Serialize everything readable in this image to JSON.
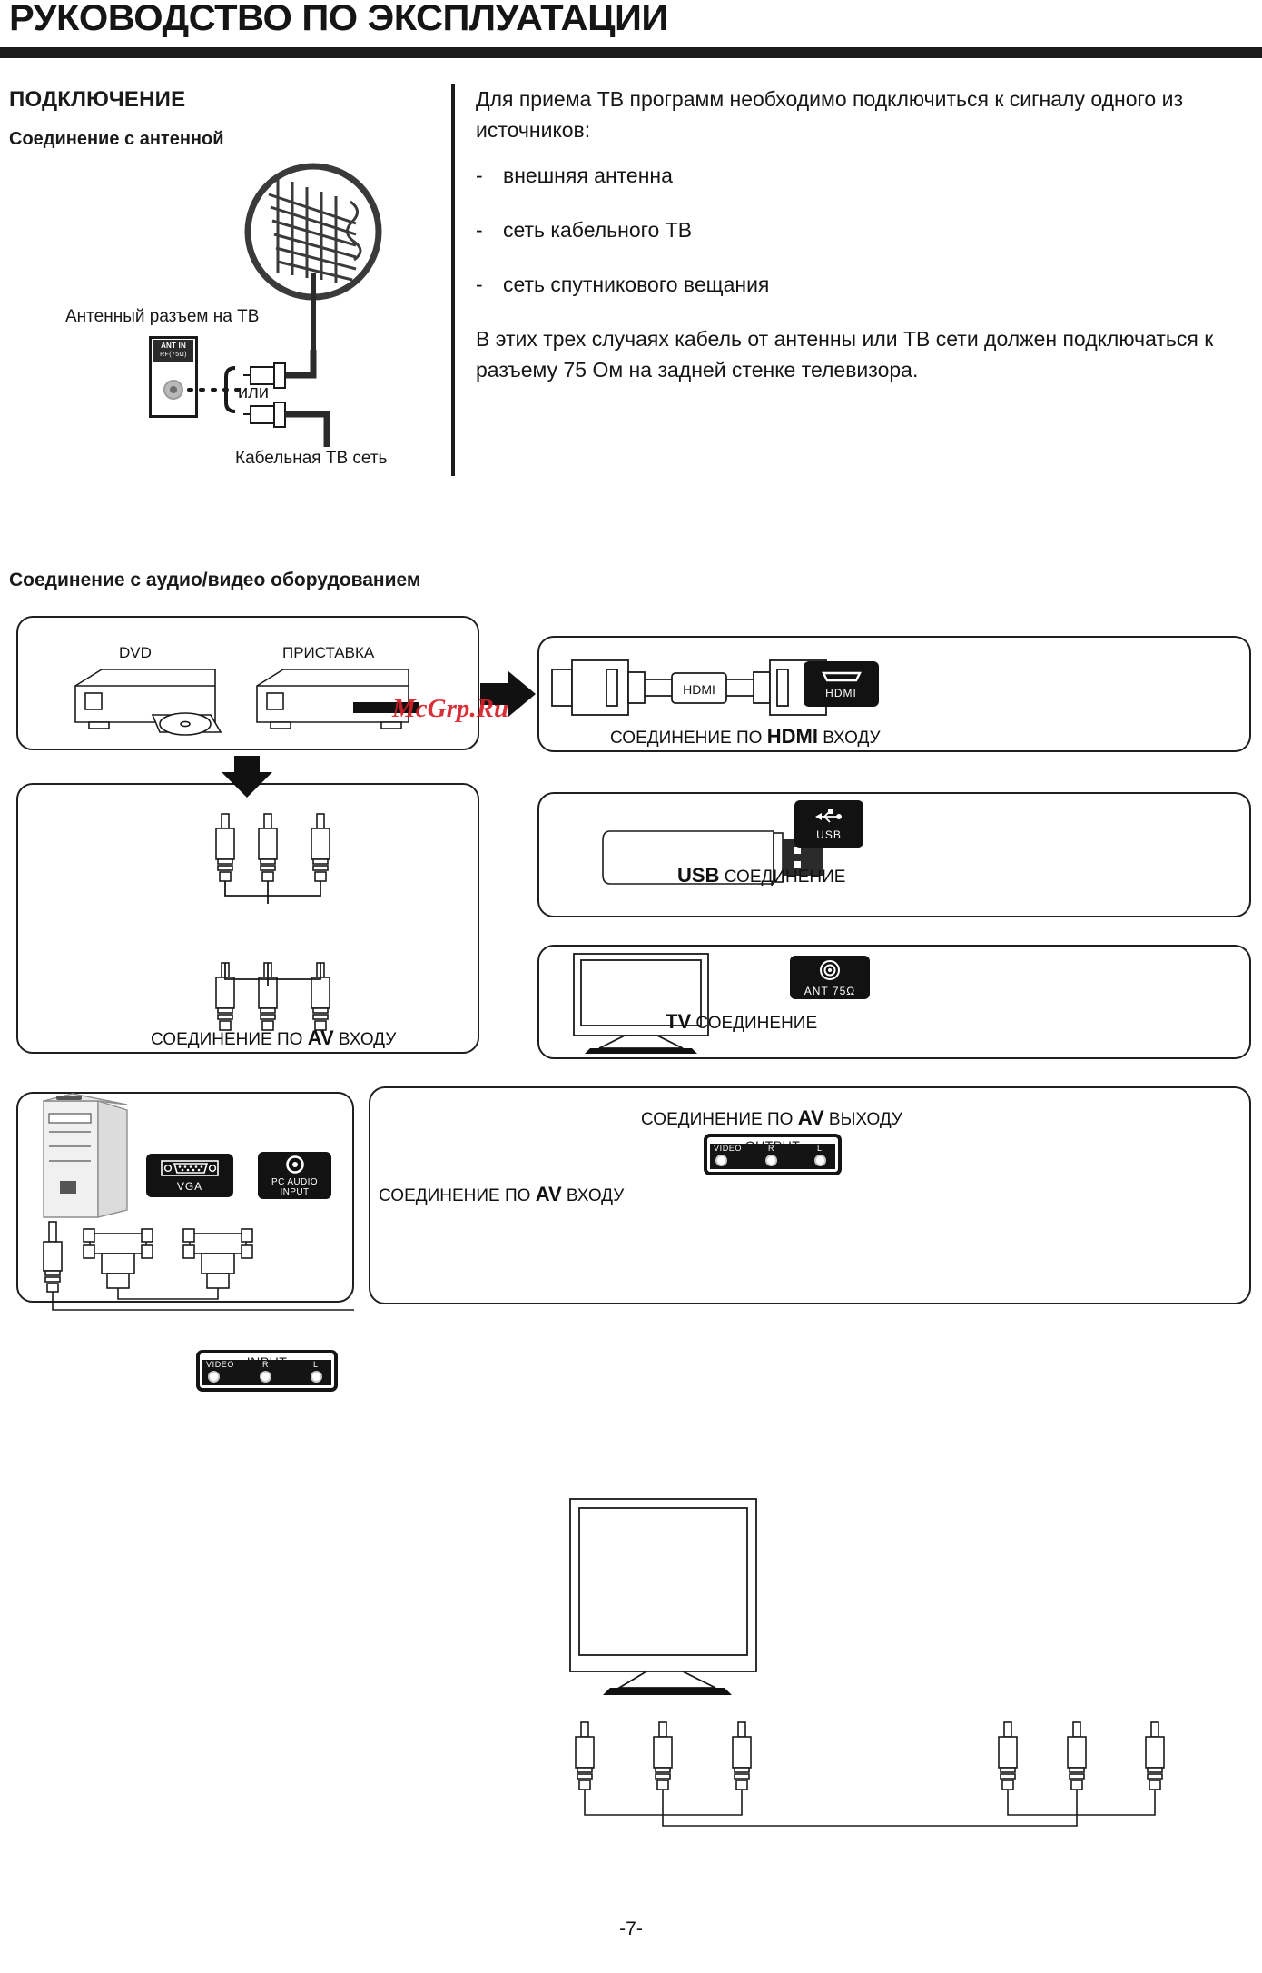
{
  "header": {
    "title": "РУКОВОДСТВО ПО ЭКСПЛУАТАЦИИ"
  },
  "section_connection": {
    "heading": "ПОДКЛЮЧЕНИЕ",
    "subheading": "Соединение с антенной",
    "intro": "Для приема ТВ программ необходимо подключиться к сигналу одного из источников:",
    "bullets": [
      {
        "marker": "-",
        "text": "внешняя антенна"
      },
      {
        "marker": "-",
        "text": "сеть кабельного ТВ"
      },
      {
        "marker": "-",
        "text": "сеть спутникового вещания"
      }
    ],
    "closing": "В этих трех случаях кабель от антенны или ТВ сети должен подключаться к разъему 75 Ом на задней стенке телевизора.",
    "diagram": {
      "tv_port_label": "Антенный разъем на ТВ",
      "port_badge_title": "ANT IN",
      "port_badge_sub": "RF(75Ω)",
      "or_label": "или",
      "cable_net_label": "Кабельная ТВ сеть"
    }
  },
  "section_av": {
    "heading": "Соединение с аудио/видео оборудованием",
    "sources": {
      "dvd_label": "DVD",
      "stb_label": "ПРИСТАВКА"
    },
    "watermark": "McGrp.Ru",
    "hdmi": {
      "cable_label": "HDMI",
      "badge_label": "HDMI",
      "caption_prefix": "СОЕДИНЕНИЕ ПО ",
      "caption_strong": "HDMI",
      "caption_suffix": " ВХОДУ"
    },
    "usb": {
      "badge_label": "USB",
      "caption_strong": "USB",
      "caption_suffix": " СОЕДИНЕНИЕ"
    },
    "tv": {
      "badge_label": "ANT 75Ω",
      "caption_strong": "TV",
      "caption_suffix": " СОЕДИНЕНИЕ"
    },
    "av_input": {
      "plate_title": "INPUT",
      "jacks": [
        "VIDEO",
        "R",
        "L"
      ],
      "caption_prefix": "СОЕДИНЕНИЕ ПО ",
      "caption_strong": "AV",
      "caption_suffix": " ВХОДУ"
    },
    "pc": {
      "vga_badge_label": "VGA",
      "audio_badge_line1": "PC AUDIO",
      "audio_badge_line2": "INPUT"
    },
    "av_output": {
      "plate_title": "OUTPUT",
      "jacks": [
        "VIDEO",
        "R",
        "L"
      ],
      "caption_out_prefix": "СОЕДИНЕНИЕ ПО ",
      "caption_out_strong": "AV",
      "caption_out_suffix": " ВЫХОДУ",
      "caption_in_prefix": "СОЕДИНЕНИЕ ПО ",
      "caption_in_strong": "AV",
      "caption_in_suffix": " ВХОДУ"
    }
  },
  "footer": {
    "page_number": "-7-"
  },
  "colors": {
    "ink": "#1a1a1a",
    "badge_bg": "#121212",
    "watermark_red": "#d42027"
  }
}
